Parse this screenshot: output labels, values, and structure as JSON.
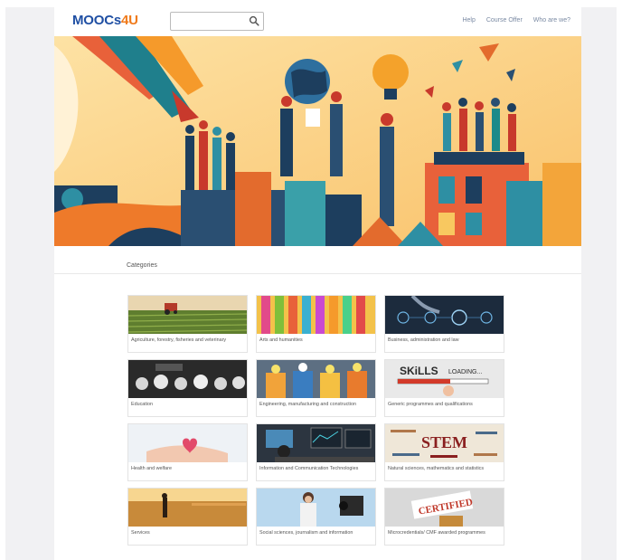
{
  "header": {
    "logo_main": "MOOCs",
    "logo_accent": "4U",
    "search_placeholder": "",
    "search_icon": "search-icon",
    "nav": [
      "Help",
      "Course Offer",
      "Who are we?"
    ]
  },
  "categories": {
    "title": "Categories",
    "items": [
      {
        "label": "Agriculture, forestry, fisheries and veterinary"
      },
      {
        "label": "Arts and humanities"
      },
      {
        "label": "Business, administration and law"
      },
      {
        "label": "Education"
      },
      {
        "label": "Engineering, manufacturing and construction"
      },
      {
        "label": "Generic programmes and qualifications"
      },
      {
        "label": "Health and welfare"
      },
      {
        "label": "Information and Communication Technologies"
      },
      {
        "label": "Natural sciences, mathematics and statistics"
      },
      {
        "label": "Services"
      },
      {
        "label": "Social sciences, journalism and information"
      },
      {
        "label": "Microcredentials/ CMF awarded programmes"
      }
    ],
    "thumb_texts": {
      "skills": "SKiLLS",
      "loading": "LOADING...",
      "stem": "STEM",
      "certified": "CERTIFIED"
    }
  }
}
